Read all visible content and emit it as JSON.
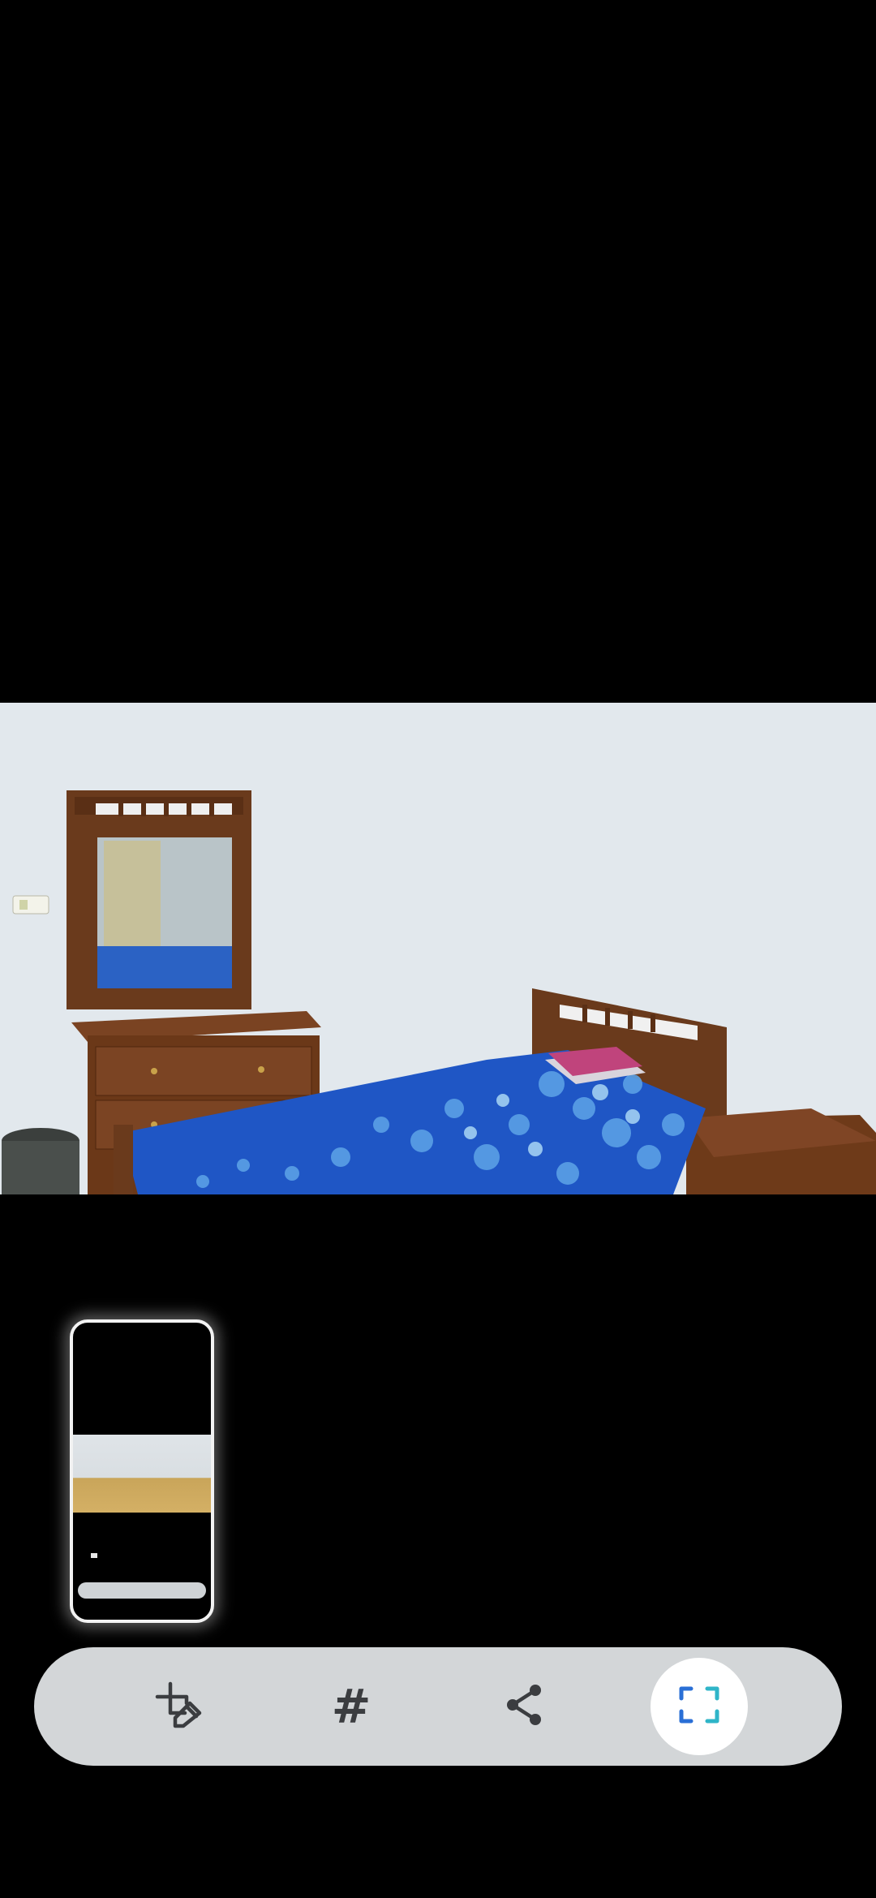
{
  "toolbar": {
    "edit_icon": "crop-edit-icon",
    "tag_icon": "hashtag-icon",
    "tag_glyph": "#",
    "share_icon": "share-icon",
    "scroll_capture_icon": "scroll-capture-icon"
  },
  "colors": {
    "background": "#000000",
    "toolbar": "#d3d6d8",
    "active_button": "#ffffff",
    "icon": "#3b3d40",
    "accent_teal": "#2fb5c8",
    "accent_blue": "#2a6fd6"
  }
}
